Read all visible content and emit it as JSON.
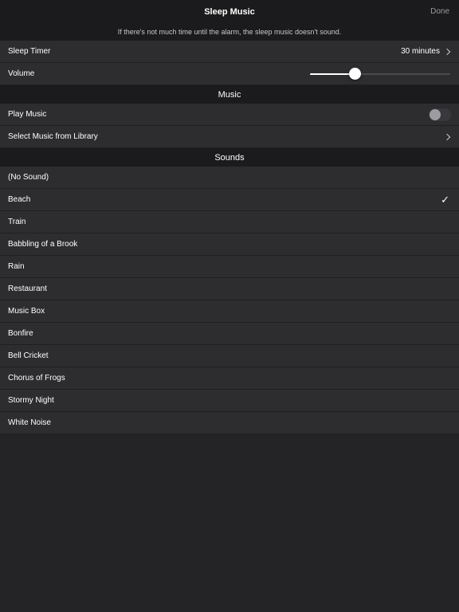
{
  "navbar": {
    "title": "Sleep Music",
    "done_label": "Done"
  },
  "notice": "If there's not much time until the alarm, the sleep music doesn't sound.",
  "settings": {
    "sleep_timer": {
      "label": "Sleep Timer",
      "value": "30 minutes"
    },
    "volume": {
      "label": "Volume",
      "level": 0.32
    }
  },
  "music": {
    "header": "Music",
    "play_music": {
      "label": "Play Music",
      "enabled": false
    },
    "select_library": {
      "label": "Select Music from Library"
    }
  },
  "sounds": {
    "header": "Sounds",
    "selected_index": 1,
    "items": [
      "(No Sound)",
      "Beach",
      "Train",
      "Babbling of a Brook",
      "Rain",
      "Restaurant",
      "Music Box",
      "Bonfire",
      "Bell Cricket",
      "Chorus of Frogs",
      "Stormy Night",
      "White Noise"
    ]
  },
  "colors": {
    "background": "#242426",
    "row": "#2d2d30",
    "header": "#1b1b1d"
  }
}
